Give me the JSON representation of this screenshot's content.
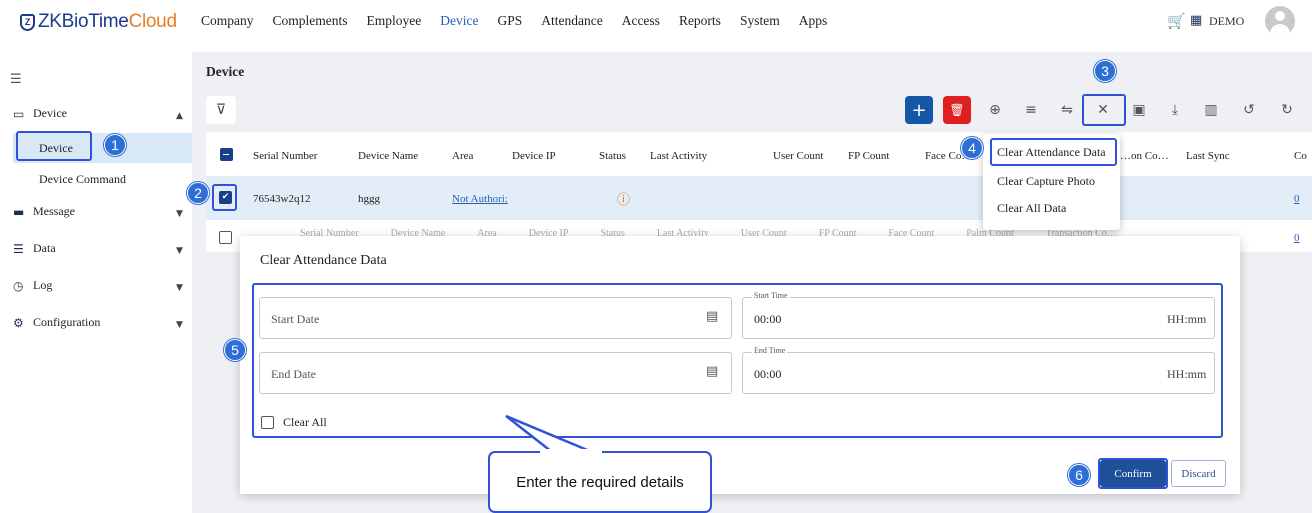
{
  "app": {
    "brand_main": "ZKBioTime",
    "brand_accent": "Cloud",
    "nav": [
      "Company",
      "Complements",
      "Employee",
      "Device",
      "GPS",
      "Attendance",
      "Access",
      "Reports",
      "System",
      "Apps"
    ],
    "active_nav": "Device",
    "user": "DEMO"
  },
  "sidebar": {
    "items": [
      {
        "label": "Device",
        "icon": "device-icon",
        "expanded": true
      },
      {
        "label": "Message",
        "icon": "message-icon"
      },
      {
        "label": "Data",
        "icon": "data-icon"
      },
      {
        "label": "Log",
        "icon": "clock-icon"
      },
      {
        "label": "Configuration",
        "icon": "gear-icon"
      }
    ],
    "sub_items": [
      "Device",
      "Device Command"
    ],
    "active_sub": "Device"
  },
  "page": {
    "title": "Device"
  },
  "toolbar": {
    "icons": [
      "add-icon",
      "delete-icon",
      "add-face-icon",
      "menu-icon",
      "transfer-icon",
      "clear-icon",
      "device-sync-icon",
      "download-icon",
      "columns-icon",
      "history-icon",
      "refresh-icon"
    ]
  },
  "table": {
    "columns": [
      "Serial Number",
      "Device Name",
      "Area",
      "Device IP",
      "Status",
      "Last Activity",
      "User Count",
      "FP Count",
      "Face Co…",
      "…on Co…",
      "Last Sync",
      "Co"
    ],
    "rows": [
      {
        "serial": "76543w2q12",
        "name": "hggg",
        "area": "Not Authori:",
        "status_icon": "warning-icon",
        "count": "0",
        "checked": true
      },
      {
        "count": "0",
        "checked": false
      }
    ],
    "ghost_header": [
      "Serial Number",
      "Device Name",
      "Area",
      "Device IP",
      "Status",
      "Last Activity",
      "User Count",
      "FP Count",
      "Face Count",
      "Palm Count",
      "Transaction Co…"
    ]
  },
  "dropdown": {
    "items": [
      "Clear Attendance Data",
      "Clear Capture Photo",
      "Clear All Data"
    ]
  },
  "dialog": {
    "title": "Clear Attendance Data",
    "start_date": "Start Date",
    "end_date": "End Date",
    "start_time_label": "Start Time",
    "end_time_label": "End Time",
    "start_time_value": "00:00",
    "end_time_value": "00:00",
    "time_format": "HH:mm",
    "clear_all": "Clear All",
    "confirm": "Confirm",
    "discard": "Discard"
  },
  "annotations": {
    "badges": [
      "1",
      "2",
      "3",
      "4",
      "5",
      "6"
    ],
    "callout": "Enter the required details",
    "color": "#2f52d9"
  }
}
